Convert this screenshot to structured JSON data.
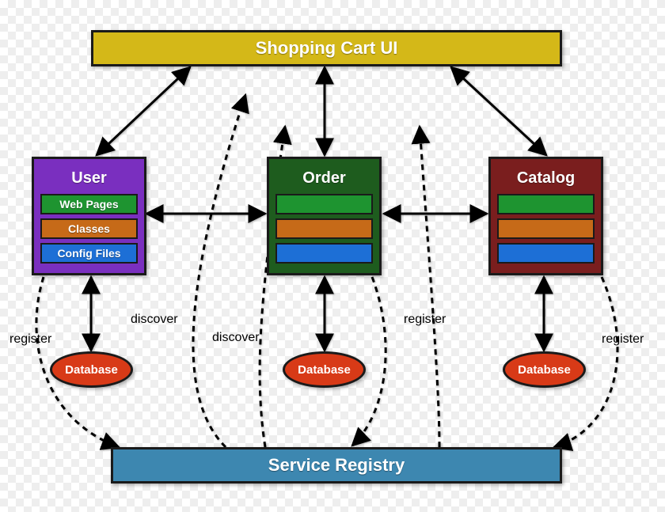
{
  "top_bar": {
    "label": "Shopping Cart UI",
    "color": "#D4B818"
  },
  "bottom_bar": {
    "label": "Service Registry",
    "color": "#3D87B0"
  },
  "services": {
    "user": {
      "title": "User",
      "color": "#7A2FBF",
      "slots": [
        {
          "label": "Web Pages",
          "color": "#1E9430"
        },
        {
          "label": "Classes",
          "color": "#C66A18"
        },
        {
          "label": "Config Files",
          "color": "#1D6FD6"
        }
      ]
    },
    "order": {
      "title": "Order",
      "color": "#1E5C1E",
      "slots": [
        {
          "label": "",
          "color": "#1E9430"
        },
        {
          "label": "",
          "color": "#C66A18"
        },
        {
          "label": "",
          "color": "#1D6FD6"
        }
      ]
    },
    "catalog": {
      "title": "Catalog",
      "color": "#7A1E1E",
      "slots": [
        {
          "label": "",
          "color": "#1E9430"
        },
        {
          "label": "",
          "color": "#C66A18"
        },
        {
          "label": "",
          "color": "#1D6FD6"
        }
      ]
    }
  },
  "database_label": "Database",
  "database_color": "#D83A17",
  "edge_labels": {
    "register": "register",
    "discover": "discover"
  }
}
